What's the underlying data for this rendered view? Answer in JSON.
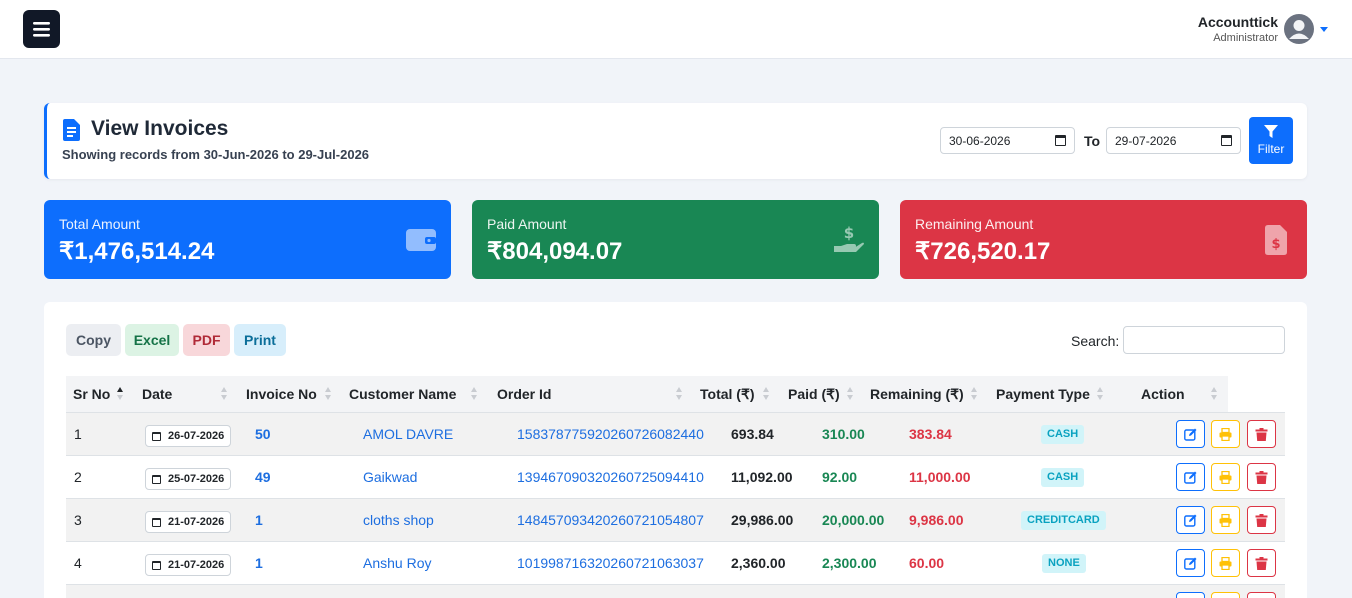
{
  "navbar": {
    "user_name": "Accounttick",
    "user_role": "Administrator"
  },
  "header": {
    "title": "View Invoices",
    "subtitle": "Showing records from 30-Jun-2026 to 29-Jul-2026",
    "from_date": "30-06-2026",
    "to_label": "To",
    "to_date": "29-07-2026",
    "filter_label": "Filter"
  },
  "stats": {
    "total": {
      "label": "Total Amount",
      "value": "₹1,476,514.24"
    },
    "paid": {
      "label": "Paid Amount",
      "value": "₹804,094.07"
    },
    "remaining": {
      "label": "Remaining Amount",
      "value": "₹726,520.17"
    }
  },
  "export_buttons": {
    "copy": "Copy",
    "excel": "Excel",
    "pdf": "PDF",
    "print": "Print"
  },
  "search": {
    "label": "Search:",
    "value": ""
  },
  "table": {
    "columns": [
      "Sr No",
      "Date",
      "Invoice No",
      "Customer Name",
      "Order Id",
      "Total (₹)",
      "Paid (₹)",
      "Remaining (₹)",
      "Payment Type",
      "Action"
    ],
    "rows": [
      {
        "sr": "1",
        "date": "26-07-2026",
        "invoice": "50",
        "customer": "AMOL DAVRE",
        "order_id": "15837877592026072608244O",
        "total": "693.84",
        "paid": "310.00",
        "remaining": "383.84",
        "payment_type": "CASH"
      },
      {
        "sr": "2",
        "date": "25-07-2026",
        "invoice": "49",
        "customer": "Gaikwad",
        "order_id": "13946709032026072509441O",
        "total": "11,092.00",
        "paid": "92.00",
        "remaining": "11,000.00",
        "payment_type": "CASH"
      },
      {
        "sr": "3",
        "date": "21-07-2026",
        "invoice": "1",
        "customer": "cloths shop",
        "order_id": "14845709342026072105480 7",
        "total": "29,986.00",
        "paid": "20,000.00",
        "remaining": "9,986.00",
        "payment_type": "CREDITCARD"
      },
      {
        "sr": "4",
        "date": "21-07-2026",
        "invoice": "1",
        "customer": "Anshu Roy",
        "order_id": "10199871632026072106303 7",
        "total": "2,360.00",
        "paid": "2,300.00",
        "remaining": "60.00",
        "payment_type": "NONE"
      }
    ]
  },
  "colors": {
    "primary": "#0d6efd",
    "success": "#198754",
    "danger": "#dc3545",
    "warning": "#ffc107",
    "info_badge_bg": "#d1f4f9",
    "info_badge_text": "#0aa2c0"
  }
}
